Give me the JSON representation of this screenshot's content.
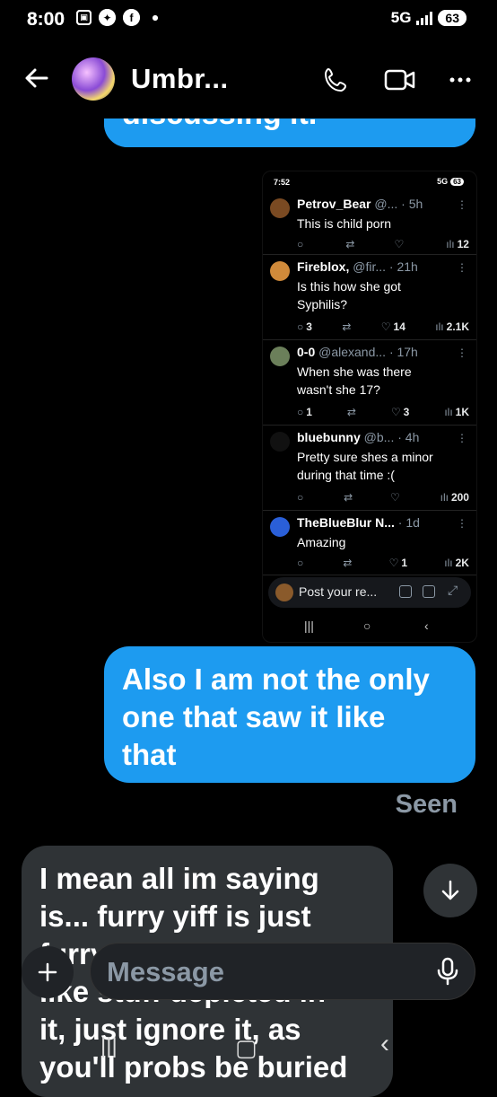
{
  "status_bar": {
    "time": "8:00",
    "network": "5G",
    "battery": "63"
  },
  "header": {
    "contact_name": "Umbr..."
  },
  "messages": {
    "top_sent": "discussing it.",
    "sent_2": [
      "Also I am not the only",
      "one that saw it like",
      "that"
    ],
    "seen": "Seen",
    "received": [
      "I mean all im saying",
      "is... furry yiff is just",
      "furry yiff if you don't",
      "like stuff depicted in",
      "it, just ignore it, as",
      "you'll probs be buried"
    ]
  },
  "embedded_screenshot": {
    "time": "7:52",
    "network": "5G",
    "battery": "63",
    "replies": [
      {
        "name": "Petrov_Bear",
        "handle": "@...",
        "age": "· 5h",
        "text": [
          "This is child porn"
        ],
        "replies": "",
        "retweets": "",
        "likes": "",
        "views": "12",
        "avatar_color": "#7a4a22"
      },
      {
        "name": "Fireblox,",
        "handle": "@fir...",
        "age": "· 21h",
        "text": [
          "Is this how she got",
          "Syphilis?"
        ],
        "replies": "3",
        "retweets": "",
        "likes": "14",
        "views": "2.1K",
        "avatar_color": "#d08a3a"
      },
      {
        "name": "0-0",
        "handle": "@alexand...",
        "age": "· 17h",
        "text": [
          "When she was there",
          "wasn't she 17?"
        ],
        "replies": "1",
        "retweets": "",
        "likes": "3",
        "views": "1K",
        "avatar_color": "#6b7f5a"
      },
      {
        "name": "bluebunny",
        "handle": "@b...",
        "age": "· 4h",
        "text": [
          "Pretty sure shes a minor",
          "during that time :("
        ],
        "replies": "",
        "retweets": "",
        "likes": "",
        "views": "200",
        "avatar_color": "#111111"
      },
      {
        "name": "TheBlueBlur N...",
        "handle": "",
        "age": "· 1d",
        "text": [
          "Amazing"
        ],
        "replies": "",
        "retweets": "",
        "likes": "1",
        "views": "2K",
        "avatar_color": "#2a5fd8"
      }
    ],
    "composer_placeholder": "Post your re..."
  },
  "composer": {
    "placeholder": "Message"
  },
  "colors": {
    "sent_bubble": "#1d9bf0",
    "received_bubble": "#2f3336",
    "background": "#000000",
    "muted": "#8b98a5"
  }
}
